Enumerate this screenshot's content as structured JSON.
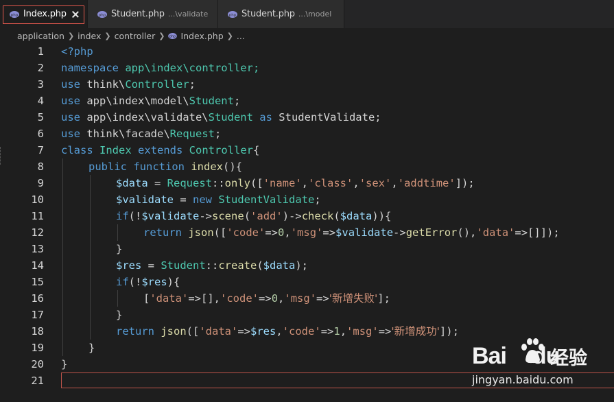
{
  "tabs": [
    {
      "name": "Index.php",
      "desc": "",
      "active": true
    },
    {
      "name": "Student.php",
      "desc": "...\\validate",
      "active": false
    },
    {
      "name": "Student.php",
      "desc": "...\\model",
      "active": false
    }
  ],
  "breadcrumb": [
    "application",
    "index",
    "controller",
    "Index.php",
    "..."
  ],
  "line_numbers": [
    "1",
    "2",
    "3",
    "4",
    "5",
    "6",
    "7",
    "8",
    "9",
    "10",
    "11",
    "12",
    "13",
    "14",
    "15",
    "16",
    "17",
    "18",
    "19",
    "20",
    "21"
  ],
  "code": {
    "l1": "<?php",
    "l2a": "namespace",
    "l2b": " app\\index\\controller;",
    "l3a": "use",
    "l3b": " think\\",
    "l3c": "Controller",
    "l3d": ";",
    "l4a": "use",
    "l4b": " app\\index\\model\\",
    "l4c": "Student",
    "l4d": ";",
    "l5a": "use",
    "l5b": " app\\index\\validate\\",
    "l5c": "Student",
    "l5d": " as",
    "l5e": " StudentValidate;",
    "l6a": "use",
    "l6b": " think\\facade\\",
    "l6c": "Request",
    "l6d": ";",
    "l7a": "class",
    "l7b": " Index",
    "l7c": " extends",
    "l7d": " Controller",
    "l7e": "{",
    "l8a": "public",
    "l8b": " function",
    "l8c": " index",
    "l8d": "(){",
    "l9a": "$data",
    "l9b": " = ",
    "l9c": "Request",
    "l9d": "::",
    "l9e": "only",
    "l9f": "([",
    "l9g": "'name'",
    "l9h": ",",
    "l9i": "'class'",
    "l9j": ",",
    "l9k": "'sex'",
    "l9l": ",",
    "l9m": "'addtime'",
    "l9n": "]);",
    "l10a": "$validate",
    "l10b": " = ",
    "l10c": "new",
    "l10d": " StudentValidate",
    "l10e": ";",
    "l11a": "if",
    "l11b": "(!",
    "l11c": "$validate",
    "l11d": "->",
    "l11e": "scene",
    "l11f": "(",
    "l11g": "'add'",
    "l11h": ")->",
    "l11i": "check",
    "l11j": "(",
    "l11k": "$data",
    "l11l": ")){",
    "l12a": "return",
    "l12b": " json",
    "l12c": "([",
    "l12d": "'code'",
    "l12e": "=>",
    "l12f": "0",
    "l12g": ",",
    "l12h": "'msg'",
    "l12i": "=>",
    "l12j": "$validate",
    "l12k": "->",
    "l12l": "getError",
    "l12m": "(),",
    "l12n": "'data'",
    "l12o": "=>[]]);",
    "l13": "}",
    "l14a": "$res",
    "l14b": " = ",
    "l14c": "Student",
    "l14d": "::",
    "l14e": "create",
    "l14f": "(",
    "l14g": "$data",
    "l14h": ");",
    "l15a": "if",
    "l15b": "(!",
    "l15c": "$res",
    "l15d": "){",
    "l16a": "[",
    "l16b": "'data'",
    "l16c": "=>[],",
    "l16d": "'code'",
    "l16e": "=>",
    "l16f": "0",
    "l16g": ",",
    "l16h": "'msg'",
    "l16i": "=>",
    "l16j": "'新增失败'",
    "l16k": "];",
    "l17": "}",
    "l18a": "return",
    "l18b": " json",
    "l18c": "([",
    "l18d": "'data'",
    "l18e": "=>",
    "l18f": "$res",
    "l18g": ",",
    "l18h": "'code'",
    "l18i": "=>",
    "l18j": "1",
    "l18k": ",",
    "l18l": "'msg'",
    "l18m": "=>",
    "l18n": "'新增成功'",
    "l18o": "]);",
    "l19": "}",
    "l20": "}",
    "l21": ""
  },
  "watermark": {
    "brand_a": "Bai",
    "brand_b": "du",
    "brand_c": "经验",
    "url": "jingyan.baidu.com"
  },
  "icons": {
    "file": "php-elephant-icon",
    "close": "close-icon",
    "chevron": "chevron-right-icon"
  },
  "colors": {
    "keyword": "#569cd6",
    "class": "#4ec9b0",
    "string": "#ce9178",
    "variable": "#9cdcfe",
    "function": "#dcdcaa",
    "number": "#b5cea8",
    "tab_highlight": "#e85a4f"
  }
}
